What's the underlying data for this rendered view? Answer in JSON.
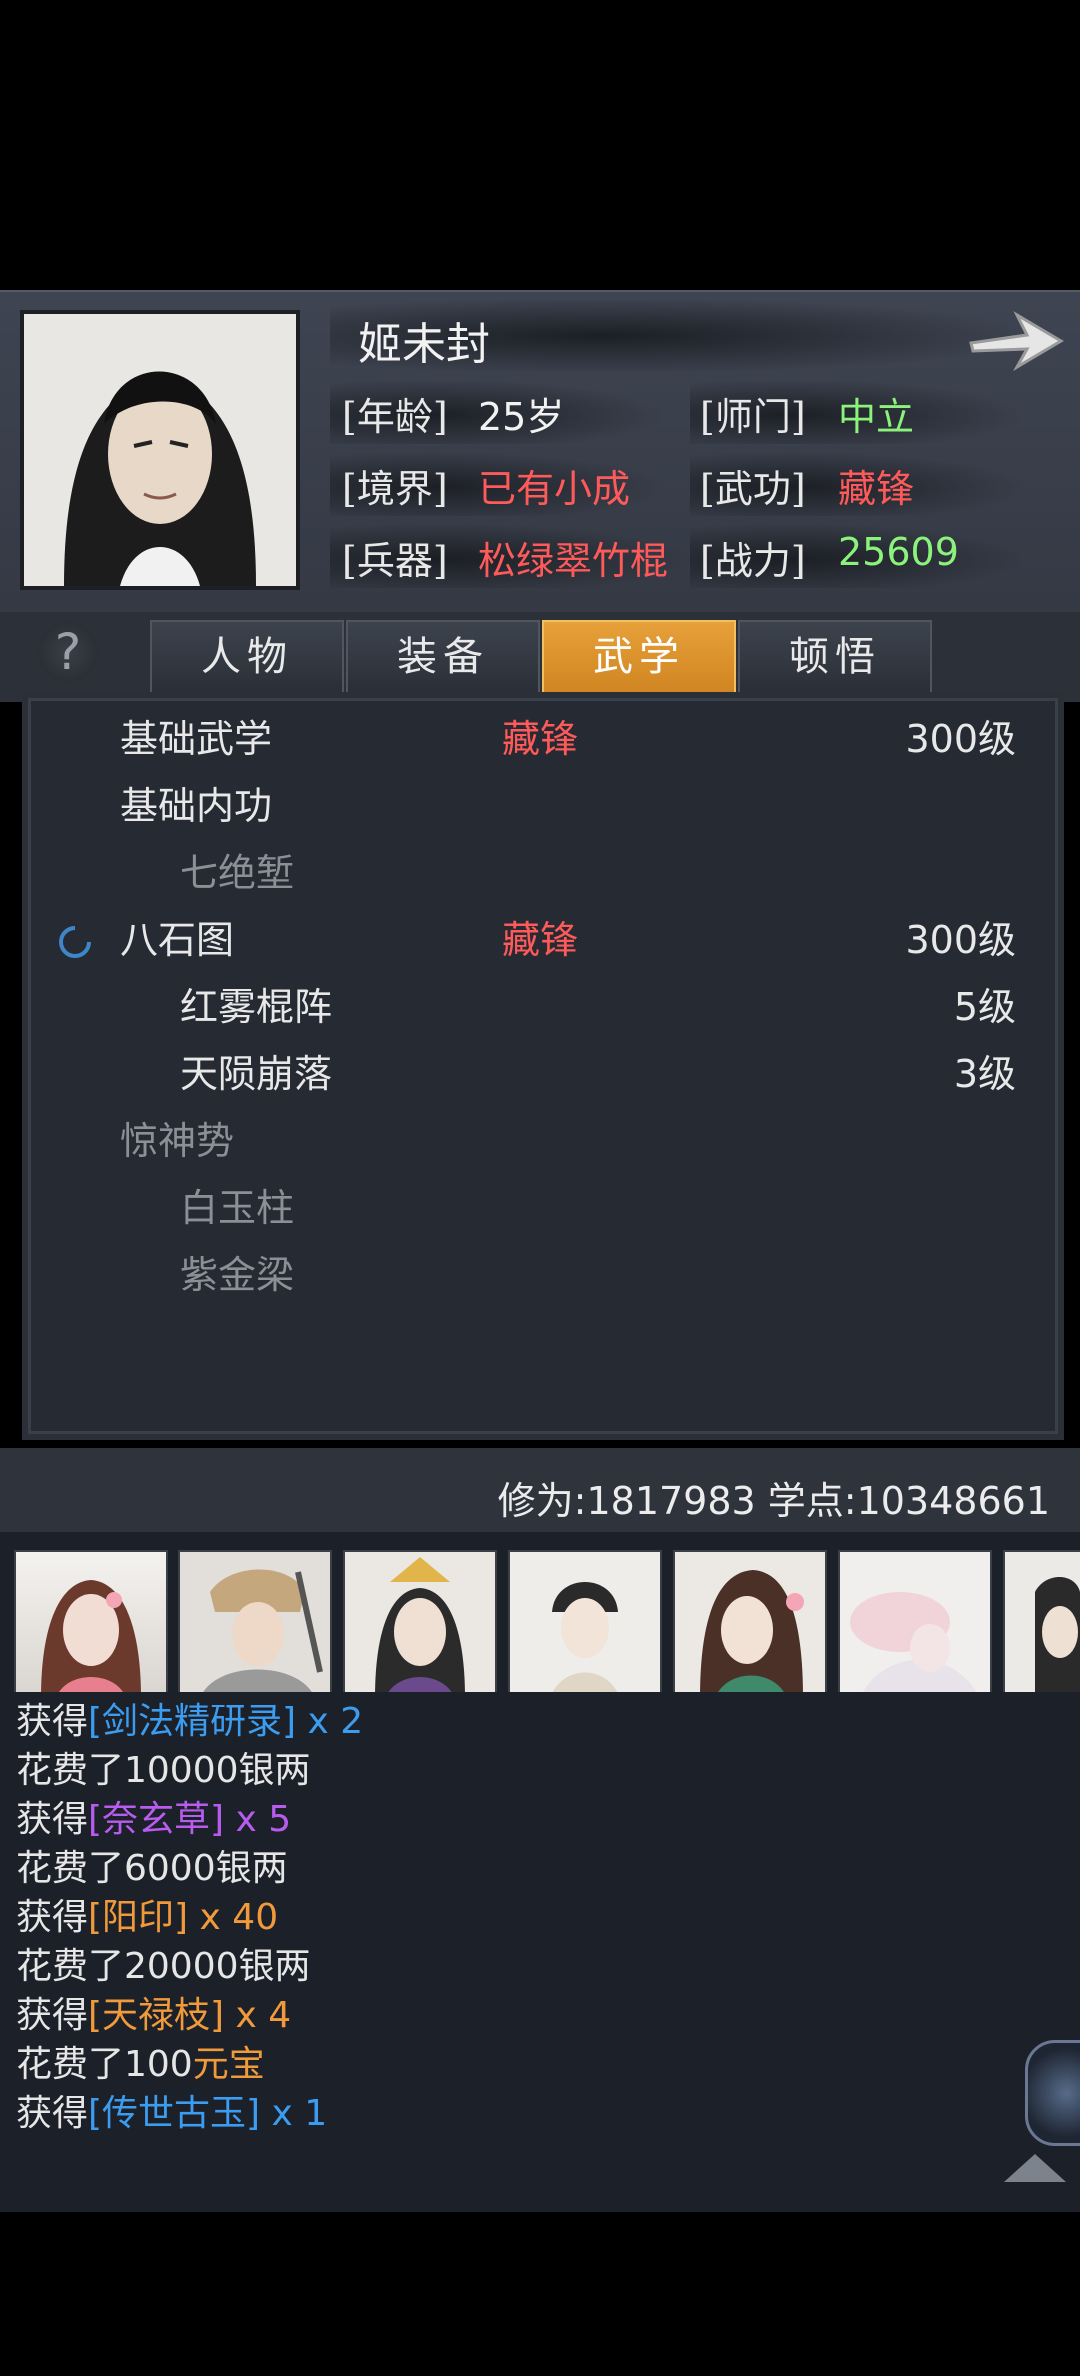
{
  "character": {
    "name": "姬未封",
    "age_label": "[年龄]",
    "age_value": "25岁",
    "sect_label": "[师门]",
    "sect_value": "中立",
    "realm_label": "[境界]",
    "realm_value": "已有小成",
    "martial_label": "[武功]",
    "martial_value": "藏锋",
    "weapon_label": "[兵器]",
    "weapon_value": "松绿翠竹棍",
    "power_label": "[战力]",
    "power_value": "25609"
  },
  "tabs": [
    {
      "label": "人物"
    },
    {
      "label": "装备"
    },
    {
      "label": "武学",
      "active": true
    },
    {
      "label": "顿悟"
    }
  ],
  "help": "?",
  "skills": [
    {
      "name": "基础武学",
      "type": "藏锋",
      "level": "300级",
      "dim": false,
      "indent": 0
    },
    {
      "name": "基础内功",
      "type": "",
      "level": "",
      "dim": false,
      "indent": 0
    },
    {
      "name": "七绝堑",
      "type": "",
      "level": "",
      "dim": true,
      "indent": 1
    },
    {
      "name": "八石图",
      "type": "藏锋",
      "level": "300级",
      "dim": false,
      "indent": 0,
      "loading": true
    },
    {
      "name": "红雾棍阵",
      "type": "",
      "level": "5级",
      "dim": false,
      "indent": 1
    },
    {
      "name": "天陨崩落",
      "type": "",
      "level": "3级",
      "dim": false,
      "indent": 1
    },
    {
      "name": "惊神势",
      "type": "",
      "level": "",
      "dim": true,
      "indent": 0
    },
    {
      "name": "白玉柱",
      "type": "",
      "level": "",
      "dim": true,
      "indent": 1
    },
    {
      "name": "紫金梁",
      "type": "",
      "level": "",
      "dim": true,
      "indent": 1
    }
  ],
  "stats": "修为:1817983  学点:10348661",
  "log": [
    {
      "prefix": "获得",
      "item": "[剑法精研录]",
      "suffix": " x 2",
      "color": "blue"
    },
    {
      "prefix": "花费了10000银两",
      "item": "",
      "suffix": "",
      "color": ""
    },
    {
      "prefix": "获得",
      "item": "[奈玄草]",
      "suffix": " x 5",
      "color": "purple"
    },
    {
      "prefix": "花费了6000银两",
      "item": "",
      "suffix": "",
      "color": ""
    },
    {
      "prefix": "获得",
      "item": "[阳印]",
      "suffix": " x 40",
      "color": "orange"
    },
    {
      "prefix": "花费了20000银两",
      "item": "",
      "suffix": "",
      "color": ""
    },
    {
      "prefix": "获得",
      "item": "[天禄枝]",
      "suffix": " x 4",
      "color": "orange"
    },
    {
      "prefix": "花费了100",
      "item": "元宝",
      "suffix": "",
      "color": "orange"
    },
    {
      "prefix": "获得",
      "item": "[传世古玉]",
      "suffix": " x 1",
      "color": "blue"
    }
  ],
  "colors": {
    "accent_tab": "#e09430",
    "red": "#ff5a5a",
    "green": "#8bf27c",
    "blue": "#3b9cf0",
    "purple": "#b85cf0",
    "orange": "#f09a3b"
  }
}
